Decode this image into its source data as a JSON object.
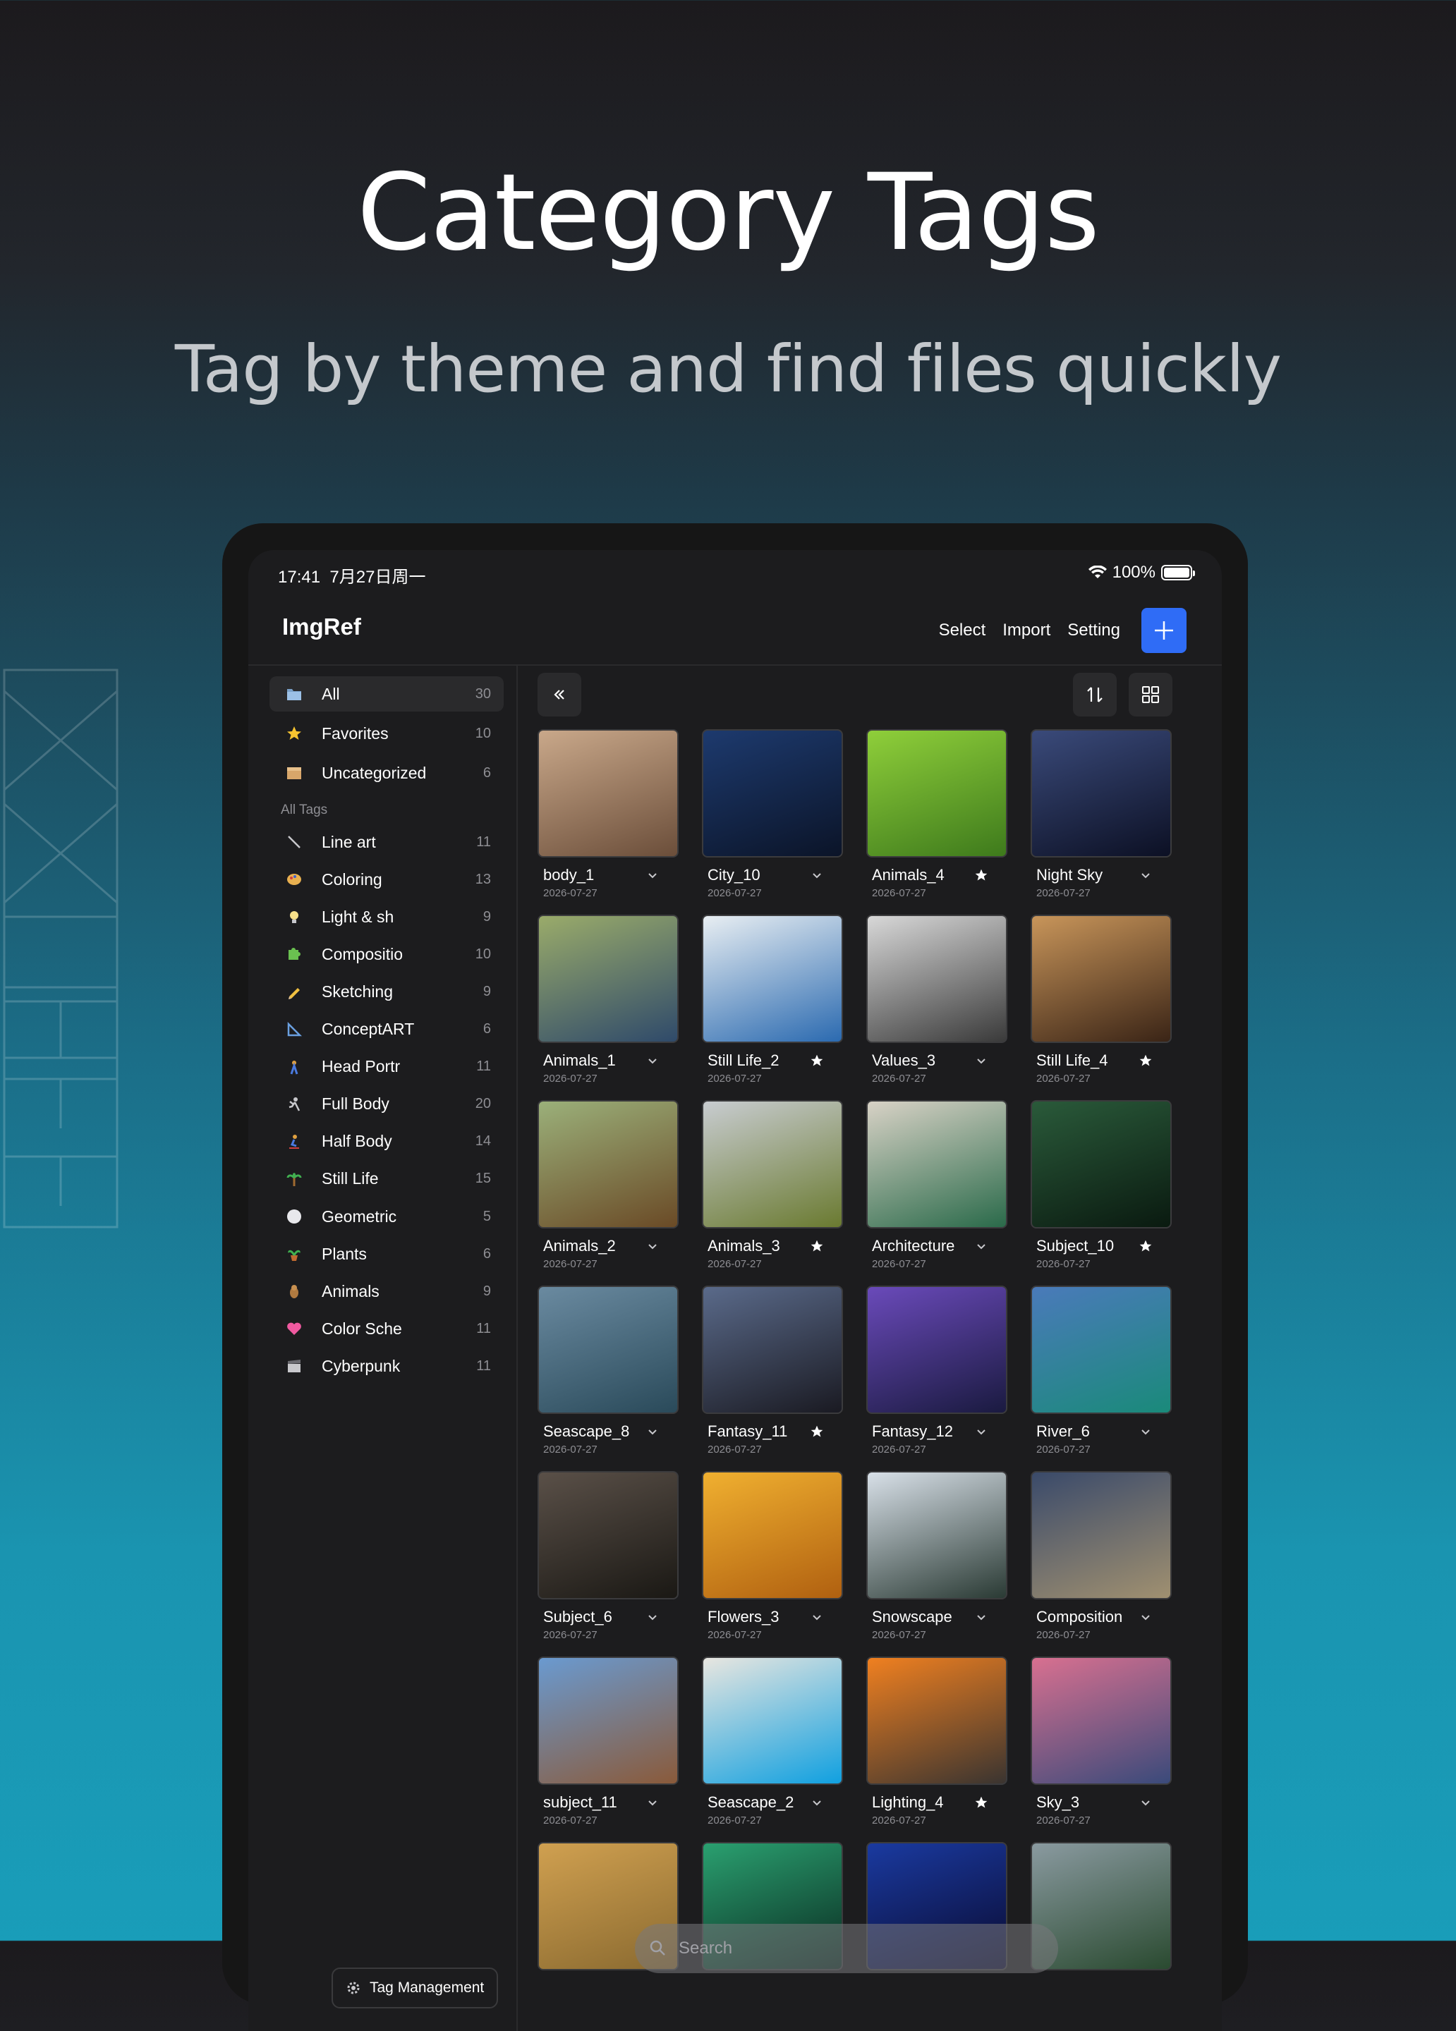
{
  "hero": {
    "title": "Category Tags",
    "subtitle": "Tag by theme and find files quickly"
  },
  "status_bar": {
    "time": "17:41",
    "date": "7月27日周一",
    "battery": "100%"
  },
  "nav": {
    "title": "ImgRef",
    "select_label": "Select",
    "import_label": "Import",
    "setting_label": "Setting"
  },
  "sidebar": {
    "main_items": [
      {
        "label": "All",
        "count": "30",
        "icon": "folder-icon"
      },
      {
        "label": "Favorites",
        "count": "10",
        "icon": "star-icon"
      },
      {
        "label": "Uncategorized",
        "count": "6",
        "icon": "box-icon"
      }
    ],
    "section_label": "All Tags",
    "tags": [
      {
        "label": "Line art",
        "count": "11",
        "icon": "pencil-line-icon"
      },
      {
        "label": "Coloring",
        "count": "13",
        "icon": "palette-icon"
      },
      {
        "label": "Light & sh",
        "count": "9",
        "icon": "bulb-icon"
      },
      {
        "label": "Compositio",
        "count": "10",
        "icon": "puzzle-icon"
      },
      {
        "label": "Sketching",
        "count": "9",
        "icon": "pencil-icon"
      },
      {
        "label": "ConceptART",
        "count": "6",
        "icon": "triangle-ruler-icon"
      },
      {
        "label": "Head Portr",
        "count": "11",
        "icon": "figure-icon"
      },
      {
        "label": "Full Body",
        "count": "20",
        "icon": "running-icon"
      },
      {
        "label": "Half Body",
        "count": "14",
        "icon": "skater-icon"
      },
      {
        "label": "Still Life",
        "count": "15",
        "icon": "palm-icon"
      },
      {
        "label": "Geometric",
        "count": "5",
        "icon": "circle-icon"
      },
      {
        "label": "Plants",
        "count": "6",
        "icon": "plant-icon"
      },
      {
        "label": "Animals",
        "count": "9",
        "icon": "animal-icon"
      },
      {
        "label": "Color Sche",
        "count": "11",
        "icon": "heart-icon"
      },
      {
        "label": "Cyberpunk",
        "count": "11",
        "icon": "clapper-icon"
      }
    ],
    "tag_management_label": "Tag Management"
  },
  "search": {
    "placeholder": "Search"
  },
  "grid": [
    {
      "name": "body_1",
      "date": "2026-07-27",
      "mark": "chevron",
      "colors": [
        "#c9a88a",
        "#6b4e3a"
      ]
    },
    {
      "name": "City_10",
      "date": "2026-07-27",
      "mark": "chevron",
      "colors": [
        "#1d3a6e",
        "#0b1428"
      ]
    },
    {
      "name": "Animals_4",
      "date": "2026-07-27",
      "mark": "star",
      "colors": [
        "#8fcf3a",
        "#3e7a1c"
      ]
    },
    {
      "name": "Night Sky",
      "date": "2026-07-27",
      "mark": "chevron",
      "colors": [
        "#3a4a7a",
        "#0c1024"
      ]
    },
    {
      "name": "Animals_1",
      "date": "2026-07-27",
      "mark": "chevron",
      "colors": [
        "#9aab6a",
        "#2f4a6a"
      ]
    },
    {
      "name": "Still Life_2",
      "date": "2026-07-27",
      "mark": "star",
      "colors": [
        "#e8eef2",
        "#2b6ab0"
      ]
    },
    {
      "name": "Values_3",
      "date": "2026-07-27",
      "mark": "chevron",
      "colors": [
        "#d8d8d8",
        "#3a3a3a"
      ]
    },
    {
      "name": "Still Life_4",
      "date": "2026-07-27",
      "mark": "star",
      "colors": [
        "#c8955a",
        "#3a2416"
      ]
    },
    {
      "name": "Animals_2",
      "date": "2026-07-27",
      "mark": "chevron",
      "colors": [
        "#9bb07a",
        "#6a4a26"
      ]
    },
    {
      "name": "Animals_3",
      "date": "2026-07-27",
      "mark": "star",
      "colors": [
        "#c8ccd0",
        "#6a7a30"
      ]
    },
    {
      "name": "Architecture",
      "date": "2026-07-27",
      "mark": "chevron",
      "colors": [
        "#d8d2c6",
        "#2a6a4a"
      ]
    },
    {
      "name": "Subject_10",
      "date": "2026-07-27",
      "mark": "star",
      "colors": [
        "#2a5a3a",
        "#0a1a10"
      ]
    },
    {
      "name": "Seascape_8",
      "date": "2026-07-27",
      "mark": "chevron",
      "colors": [
        "#6a8aa0",
        "#2a4a5a"
      ]
    },
    {
      "name": "Fantasy_11",
      "date": "2026-07-27",
      "mark": "star",
      "colors": [
        "#5a6a8a",
        "#1a1a22"
      ]
    },
    {
      "name": "Fantasy_12",
      "date": "2026-07-27",
      "mark": "chevron",
      "colors": [
        "#6a4aba",
        "#1a1a40"
      ]
    },
    {
      "name": "River_6",
      "date": "2026-07-27",
      "mark": "chevron",
      "colors": [
        "#4a7aba",
        "#1a8a7a"
      ]
    },
    {
      "name": "Subject_6",
      "date": "2026-07-27",
      "mark": "chevron",
      "colors": [
        "#5a5048",
        "#1a1814"
      ]
    },
    {
      "name": "Flowers_3",
      "date": "2026-07-27",
      "mark": "chevron",
      "colors": [
        "#f0b030",
        "#b06010"
      ]
    },
    {
      "name": "Snowscape",
      "date": "2026-07-27",
      "mark": "chevron",
      "colors": [
        "#d8e0e8",
        "#2a3a34"
      ]
    },
    {
      "name": "Composition",
      "date": "2026-07-27",
      "mark": "chevron",
      "colors": [
        "#3a4a6a",
        "#a09070"
      ]
    },
    {
      "name": "subject_11",
      "date": "2026-07-27",
      "mark": "chevron",
      "colors": [
        "#6a9ad0",
        "#8a5a3a"
      ]
    },
    {
      "name": "Seascape_2",
      "date": "2026-07-27",
      "mark": "chevron",
      "colors": [
        "#e8e6e0",
        "#10a0e0"
      ]
    },
    {
      "name": "Lighting_4",
      "date": "2026-07-27",
      "mark": "star",
      "colors": [
        "#f08020",
        "#3a3430"
      ]
    },
    {
      "name": "Sky_3",
      "date": "2026-07-27",
      "mark": "chevron",
      "colors": [
        "#d87090",
        "#3a4a7a"
      ]
    },
    {
      "name": "",
      "date": "",
      "mark": "none",
      "colors": [
        "#d0a050",
        "#8a6a30"
      ]
    },
    {
      "name": "",
      "date": "",
      "mark": "none",
      "colors": [
        "#2aa070",
        "#0a2a20"
      ]
    },
    {
      "name": "",
      "date": "",
      "mark": "none",
      "colors": [
        "#1a3aa0",
        "#0a0a30"
      ]
    },
    {
      "name": "",
      "date": "",
      "mark": "none",
      "colors": [
        "#8a9aa0",
        "#2a4a30"
      ]
    }
  ],
  "accent_color": "#2f6cf6"
}
